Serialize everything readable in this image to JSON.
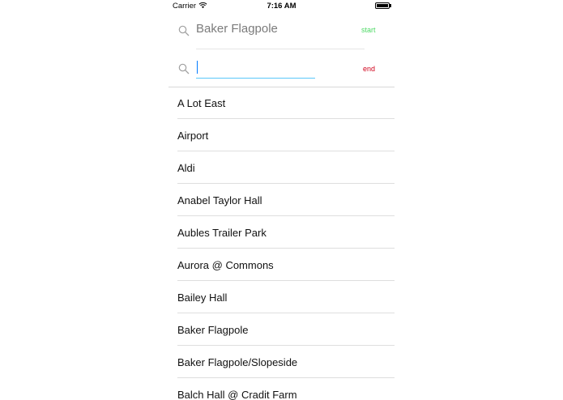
{
  "status_bar": {
    "carrier": "Carrier",
    "time": "7:16 AM"
  },
  "start_search": {
    "value": "Baker Flagpole",
    "tag": "start",
    "tag_color": "#4cd964"
  },
  "end_search": {
    "value": "",
    "placeholder": "",
    "tag": "end",
    "tag_color": "#d0021b"
  },
  "stops": [
    "A Lot East",
    "Airport",
    "Aldi",
    "Anabel Taylor Hall",
    "Aubles Trailer Park",
    "Aurora @ Commons",
    "Bailey Hall",
    "Baker Flagpole",
    "Baker Flagpole/Slopeside",
    "Balch Hall @ Cradit Farm"
  ]
}
